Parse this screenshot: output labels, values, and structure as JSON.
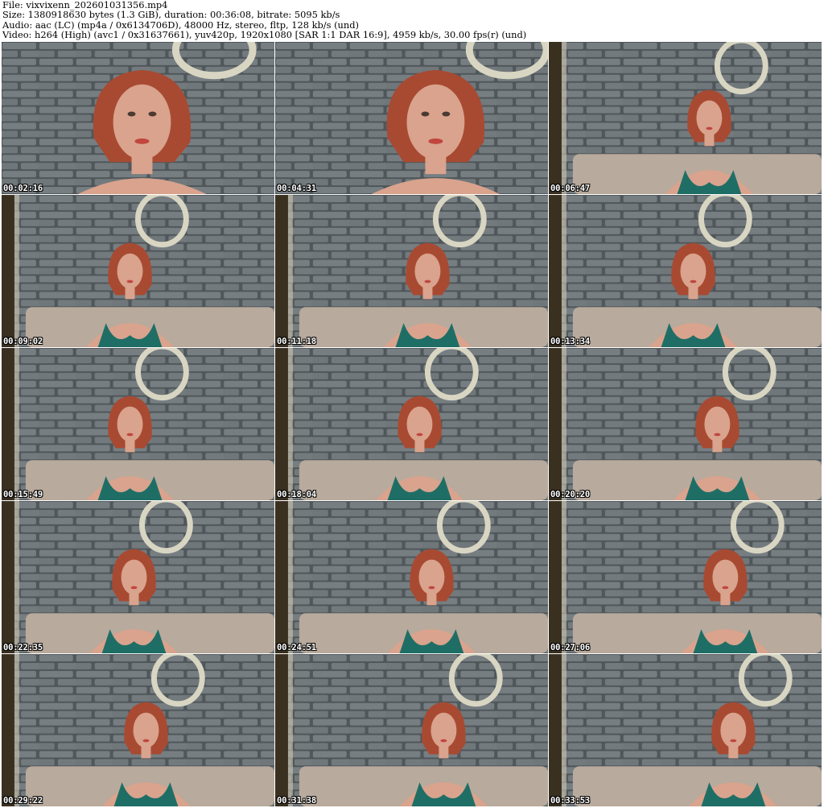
{
  "header": {
    "file_line": "File: vixvixenn_202601031356.mp4",
    "size_line": "Size: 1380918630 bytes (1.3 GiB), duration: 00:36:08, bitrate: 5095 kb/s",
    "audio_line": "Audio: aac (LC) (mp4a / 0x6134706D), 48000 Hz, stereo, fltp, 128 kb/s (und)",
    "video_line": "Video: h264 (High) (avc1 / 0x31637661), yuv420p, 1920x1080 [SAR 1:1 DAR 16:9], 4959 kb/s, 30.00 fps(r) (und)"
  },
  "colors": {
    "wall": "#50575b",
    "brick": "#7d8588",
    "hair": "#a84a32",
    "skin": "#d9a38d",
    "top": "#1f6e66",
    "sofa": "#b8aa9c",
    "mirror": "#d8d6c2"
  },
  "frames": [
    {
      "time": "00:02:16",
      "view": "close"
    },
    {
      "time": "00:04:31",
      "view": "close"
    },
    {
      "time": "00:06:47",
      "view": "wide"
    },
    {
      "time": "00:09:02",
      "view": "wide"
    },
    {
      "time": "00:11:18",
      "view": "wide"
    },
    {
      "time": "00:13:34",
      "view": "wide"
    },
    {
      "time": "00:15:49",
      "view": "wide"
    },
    {
      "time": "00:18:04",
      "view": "wide"
    },
    {
      "time": "00:20:20",
      "view": "wide"
    },
    {
      "time": "00:22:35",
      "view": "wide"
    },
    {
      "time": "00:24:51",
      "view": "wide"
    },
    {
      "time": "00:27:06",
      "view": "wide"
    },
    {
      "time": "00:29:22",
      "view": "wide"
    },
    {
      "time": "00:31:38",
      "view": "wide"
    },
    {
      "time": "00:33:53",
      "view": "wide"
    }
  ]
}
